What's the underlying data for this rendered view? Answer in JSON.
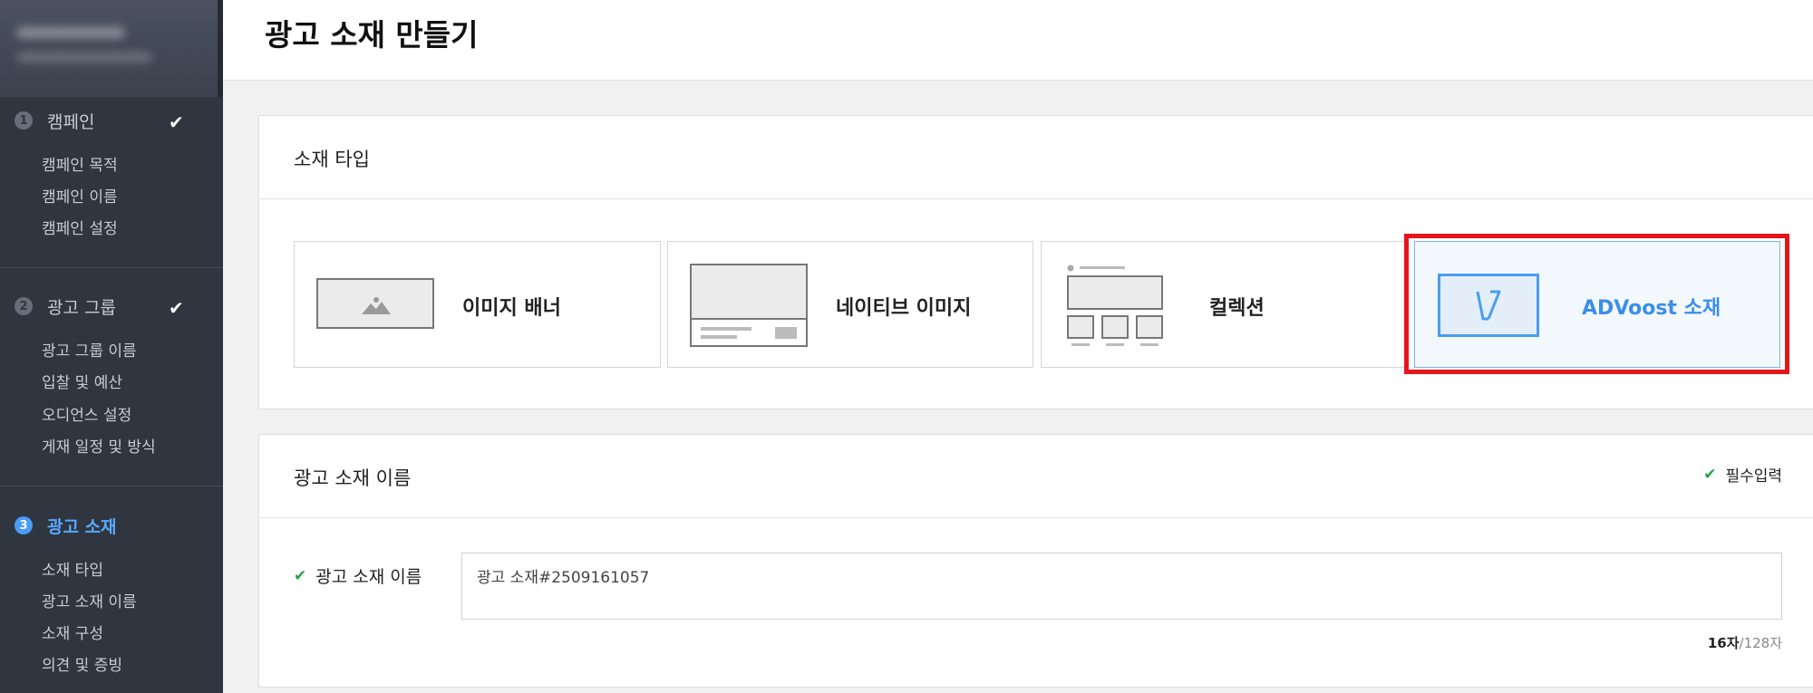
{
  "page_title": "광고 소재 만들기",
  "sidebar": {
    "steps": [
      {
        "num": "1",
        "title": "캠페인",
        "done": true,
        "items": [
          "캠페인 목적",
          "캠페인 이름",
          "캠페인 설정"
        ]
      },
      {
        "num": "2",
        "title": "광고 그룹",
        "done": true,
        "items": [
          "광고 그룹 이름",
          "입찰 및 예산",
          "오디언스 설정",
          "게재 일정 및 방식"
        ]
      },
      {
        "num": "3",
        "title": "광고 소재",
        "done": false,
        "active": true,
        "items": [
          "소재 타입",
          "광고 소재 이름",
          "소재 구성",
          "의견 및 증빙"
        ]
      }
    ],
    "check_glyph": "✔"
  },
  "creative_type": {
    "section_title": "소재 타입",
    "options": [
      {
        "label": "이미지 배너",
        "icon": "image-banner-icon",
        "selected": false
      },
      {
        "label": "네이티브 이미지",
        "icon": "native-image-icon",
        "selected": false
      },
      {
        "label": "컬렉션",
        "icon": "collection-icon",
        "selected": false
      },
      {
        "label": "ADVoost 소재",
        "icon": "advoost-icon",
        "selected": true
      }
    ]
  },
  "creative_name": {
    "section_title": "광고 소재 이름",
    "required_label": "필수입력",
    "field_label": "광고 소재 이름",
    "value": "광고 소재#2509161057",
    "counter_current": "16자",
    "counter_max": "/128자"
  },
  "colors": {
    "accent": "#3b8ee8",
    "highlight": "#e4161b",
    "sidebar_bg": "#2f3640",
    "check_green": "#2aa046"
  }
}
